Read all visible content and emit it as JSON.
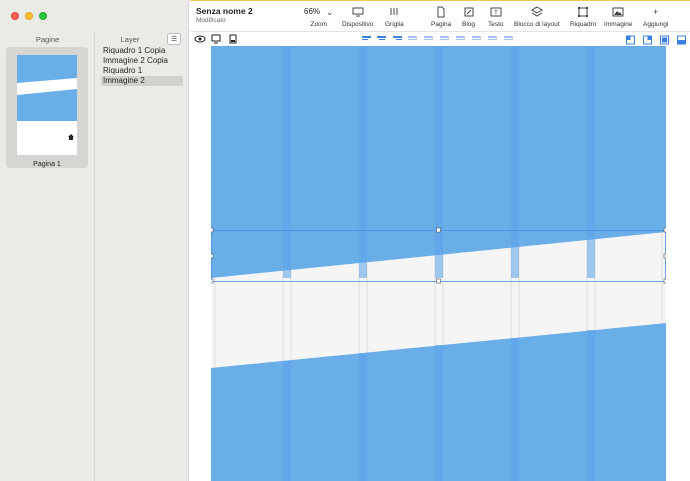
{
  "window": {
    "title": "Senza nome 2",
    "subtitle": "Modificato"
  },
  "pages_panel": {
    "title": "Pagine",
    "pages": [
      {
        "label": "Pagina 1"
      }
    ]
  },
  "layers_panel": {
    "title": "Layer",
    "items": [
      {
        "label": "Riquadro 1 Copia",
        "selected": false
      },
      {
        "label": "Immagine 2 Copia",
        "selected": false
      },
      {
        "label": "Riquadro 1",
        "selected": false
      },
      {
        "label": "Immagine 2",
        "selected": true
      }
    ]
  },
  "toolbar": {
    "zoom": {
      "value": "66%",
      "label": "Zoom"
    },
    "dispositivo": "Dispositivo",
    "griglia": "Griglia",
    "pagina": "Pagina",
    "blog": "Blog",
    "testo": "Testo",
    "blocco_layout": "Blocco di layout",
    "riquadro": "Riquadro",
    "immagine": "Immagine",
    "aggiungi": "Aggiungi"
  },
  "colors": {
    "accent": "#3b82e0",
    "image_fill": "#6aaee8",
    "grid_column": "#5aa2ea",
    "selection": "#4a8fe0",
    "window_bg": "#ebeae6"
  }
}
